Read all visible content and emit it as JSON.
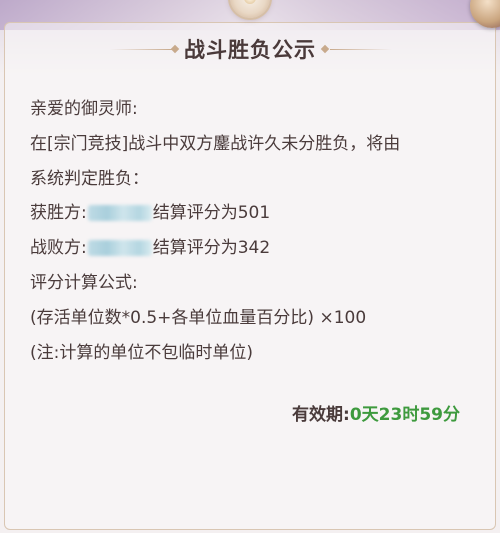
{
  "dialog": {
    "title": "战斗胜负公示"
  },
  "content": {
    "greeting": "亲爱的御灵师:",
    "line1": "在[宗门竞技]战斗中双方鏖战许久未分胜负，将由",
    "line2": "系统判定胜负：",
    "winner_prefix": "获胜方:",
    "winner_suffix": "结算评分为501",
    "loser_prefix": "战败方:",
    "loser_suffix": "结算评分为342",
    "formula_label": "评分计算公式:",
    "formula": "(存活单位数*0.5+各单位血量百分比) ×100",
    "note": "(注:计算的单位不包临时单位)"
  },
  "validity": {
    "label": "有效期:",
    "value": "0天23时59分"
  },
  "colors": {
    "accent_green": "#3e9a3e",
    "text": "#4a3b3b"
  },
  "icons": {
    "emblem": "emblem-icon",
    "close": "close-icon"
  }
}
